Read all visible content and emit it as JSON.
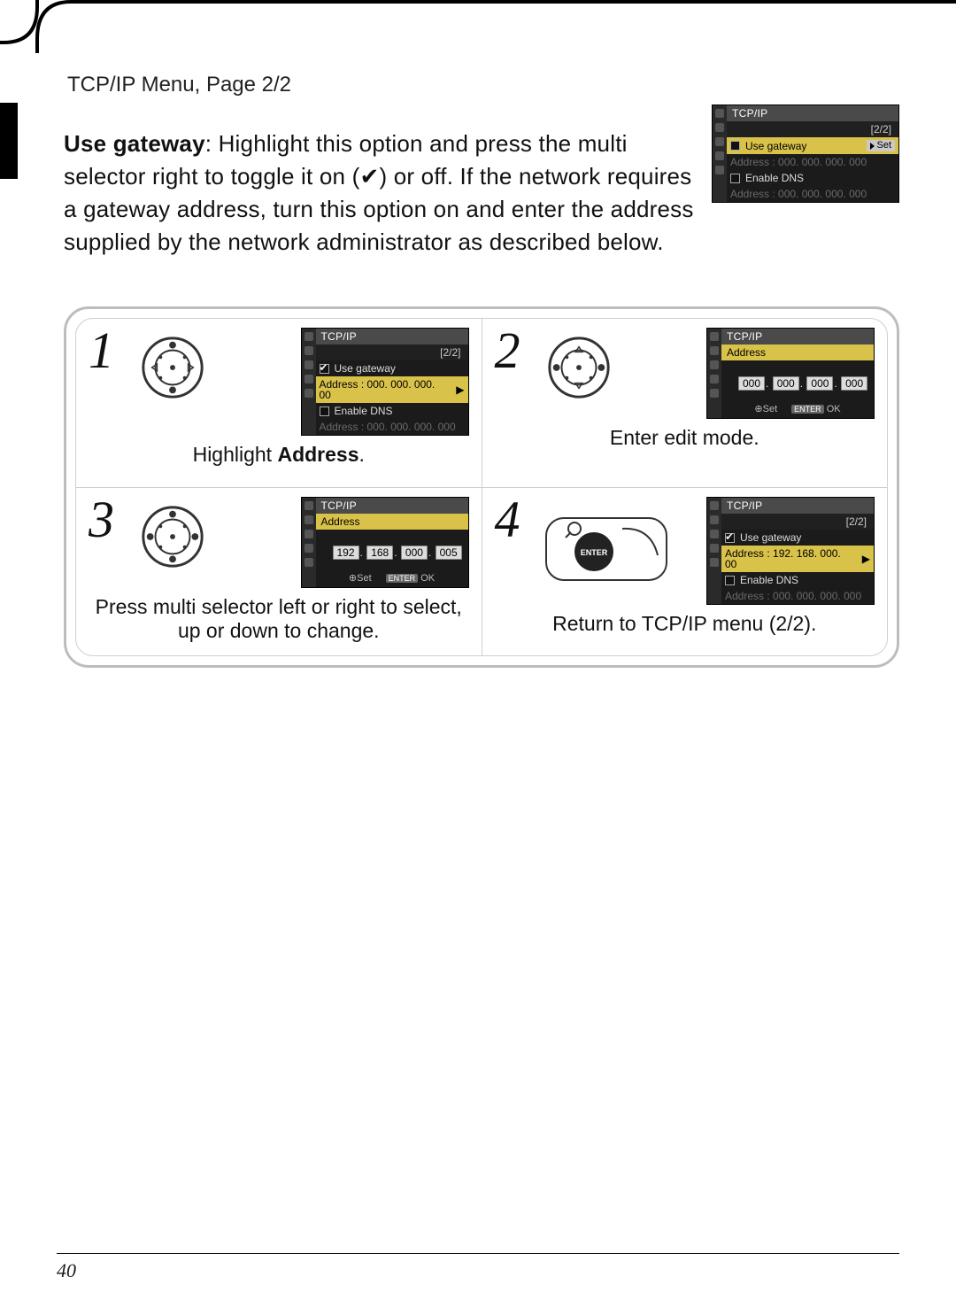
{
  "page": {
    "subhead": "TCP/IP Menu, Page 2/2",
    "number": "40"
  },
  "intro": {
    "lead": "Use gateway",
    "text_after_lead": ": Highlight this option and press the multi selector right to toggle it on (✔) or off.  If the network requires a gateway address, turn this option on and enter the address supplied by the network administrator as described below."
  },
  "lcd_main": {
    "title": "TCP/IP",
    "pager": "[2/2]",
    "use_gateway": "Use gateway",
    "set": "Set",
    "addr_label_dim": "Address : 000. 000. 000. 000",
    "enable_dns": "Enable DNS",
    "addr2_dim": "Address : 000. 000. 000. 000"
  },
  "steps": [
    {
      "num": "1",
      "caption_pre": "Highlight ",
      "caption_bold": "Address",
      "caption_post": ".",
      "lcd": {
        "title": "TCP/IP",
        "pager": "[2/2]",
        "use_gateway": "Use gateway",
        "addr_hl": "Address : 000. 000. 000. 00",
        "enable_dns": "Enable DNS",
        "addr_dim": "Address : 000. 000. 000. 000"
      }
    },
    {
      "num": "2",
      "caption": "Enter edit mode.",
      "lcd": {
        "title": "TCP/IP",
        "sub": "Address",
        "ip": [
          "000",
          "000",
          "000",
          "000"
        ],
        "foot_set": "Set",
        "foot_ok": "OK",
        "foot_tag": "ENTER"
      }
    },
    {
      "num": "3",
      "caption": "Press multi selector left or right to select, up or down to change.",
      "lcd": {
        "title": "TCP/IP",
        "sub": "Address",
        "ip": [
          "192",
          "168",
          "000",
          "005"
        ],
        "foot_set": "Set",
        "foot_ok": "OK",
        "foot_tag": "ENTER"
      }
    },
    {
      "num": "4",
      "caption": "Return to TCP/IP menu (2/2).",
      "lcd": {
        "title": "TCP/IP",
        "pager": "[2/2]",
        "use_gateway": "Use gateway",
        "addr_hl": "Address : 192. 168. 000. 00",
        "enable_dns": "Enable DNS",
        "addr_dim": "Address : 000. 000. 000. 000"
      }
    }
  ]
}
